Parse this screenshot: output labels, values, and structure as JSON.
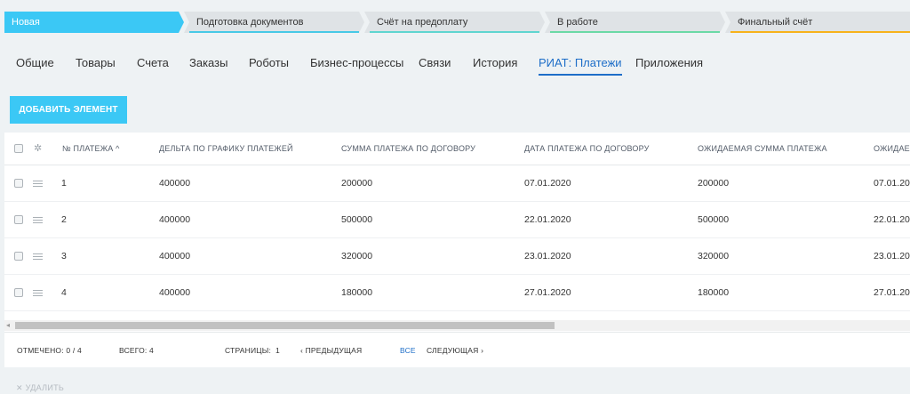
{
  "stages": [
    {
      "label": "Новая",
      "color": "#3bc8f5",
      "active": true
    },
    {
      "label": "Подготовка документов",
      "color": "#47c9e6"
    },
    {
      "label": "Счёт на предоплату",
      "color": "#5fd5d0"
    },
    {
      "label": "В работе",
      "color": "#6bd9a6"
    },
    {
      "label": "Финальный счёт",
      "color": "#f7b31b"
    }
  ],
  "tabs": [
    "Общие",
    "Товары",
    "Счета",
    "Заказы",
    "Роботы",
    "Бизнес-процессы",
    "Связи",
    "История",
    "РИАТ: Платежи",
    "Приложения"
  ],
  "active_tab": "РИАТ: Платежи",
  "add_button": "ДОБАВИТЬ ЭЛЕМЕНТ",
  "table": {
    "columns": [
      "№ ПЛАТЕЖА",
      "ДЕЛЬТА ПО ГРАФИКУ ПЛАТЕЖЕЙ",
      "СУММА ПЛАТЕЖА ПО ДОГОВОРУ",
      "ДАТА ПЛАТЕЖА ПО ДОГОВОРУ",
      "ОЖИДАЕМАЯ СУММА ПЛАТЕЖА",
      "ОЖИДАЕ"
    ],
    "sort_icon": "chevron-up-icon",
    "rows": [
      [
        "1",
        "400000",
        "200000",
        "07.01.2020",
        "200000",
        "07.01.20"
      ],
      [
        "2",
        "400000",
        "500000",
        "22.01.2020",
        "500000",
        "22.01.20"
      ],
      [
        "3",
        "400000",
        "320000",
        "23.01.2020",
        "320000",
        "23.01.20"
      ],
      [
        "4",
        "400000",
        "180000",
        "27.01.2020",
        "180000",
        "27.01.20"
      ]
    ]
  },
  "footer": {
    "selected": "ОТМЕЧЕНО: 0 / 4",
    "total": "ВСЕГО: 4",
    "pages_label": "СТРАНИЦЫ:",
    "page": "1",
    "prev": "‹ ПРЕДЫДУЩАЯ",
    "all": "ВСЕ",
    "next": "СЛЕДУЮЩАЯ ›"
  },
  "delete_button": "✕ УДАЛИТЬ"
}
